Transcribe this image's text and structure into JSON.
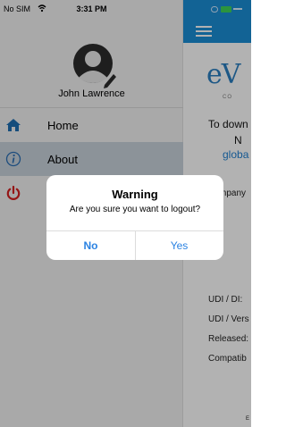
{
  "status_bar": {
    "carrier": "No SIM",
    "time": "3:31 PM"
  },
  "drawer": {
    "user_name": "John Lawrence",
    "menu": [
      {
        "label": "Home",
        "icon": "home-icon"
      },
      {
        "label": "About",
        "icon": "info-icon"
      },
      {
        "label": "",
        "icon": "power-icon"
      }
    ]
  },
  "main": {
    "logo_text": "eV",
    "logo_sub": "CO",
    "lines": [
      {
        "text": "To down"
      },
      {
        "text": "N"
      },
      {
        "text": "globa"
      },
      {
        "text": "mpany"
      },
      {
        "text": "UDI / DI:"
      },
      {
        "text": "UDI / Vers"
      },
      {
        "text": "Released:"
      },
      {
        "text": "Compatib"
      },
      {
        "text": "E"
      }
    ]
  },
  "dialog": {
    "title": "Warning",
    "message": "Are you sure you want to logout?",
    "no_label": "No",
    "yes_label": "Yes"
  },
  "colors": {
    "accent": "#1b8ed6",
    "link": "#2a82e2",
    "active_row": "#c9d3dc",
    "home_icon": "#1f6fb2",
    "info_icon": "#2a6fb5",
    "power_icon": "#d62020"
  }
}
